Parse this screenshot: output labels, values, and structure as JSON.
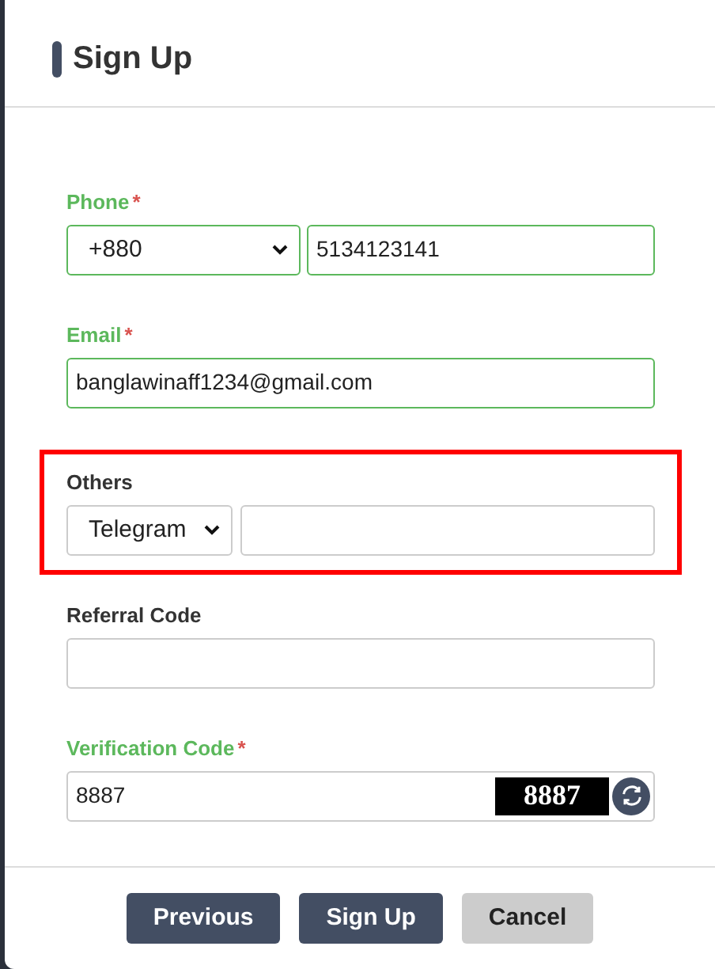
{
  "dialog": {
    "title": "Sign Up"
  },
  "fields": [
    {
      "kind": "phone",
      "label": "Phone",
      "required_mark": "*",
      "valid": true,
      "highlighted": false,
      "option": "+880",
      "value": "5134123141"
    },
    {
      "kind": "text",
      "label": "Email",
      "required_mark": "*",
      "valid": true,
      "highlighted": false,
      "value": "banglawinaff1234@gmail.com"
    },
    {
      "kind": "contact",
      "label": "Others",
      "valid": false,
      "highlighted": true,
      "option": "Telegram"
    },
    {
      "kind": "text",
      "label": "Referral Code",
      "valid": false,
      "highlighted": false
    },
    {
      "kind": "captcha",
      "label": "Verification Code",
      "required_mark": "*",
      "valid": true,
      "highlighted": false,
      "value": "8887",
      "captcha": "8887"
    }
  ],
  "buttons": [
    {
      "label": "Previous",
      "kind": "primary"
    },
    {
      "label": "Sign Up",
      "kind": "primary"
    },
    {
      "label": "Cancel",
      "kind": "secondary"
    }
  ]
}
